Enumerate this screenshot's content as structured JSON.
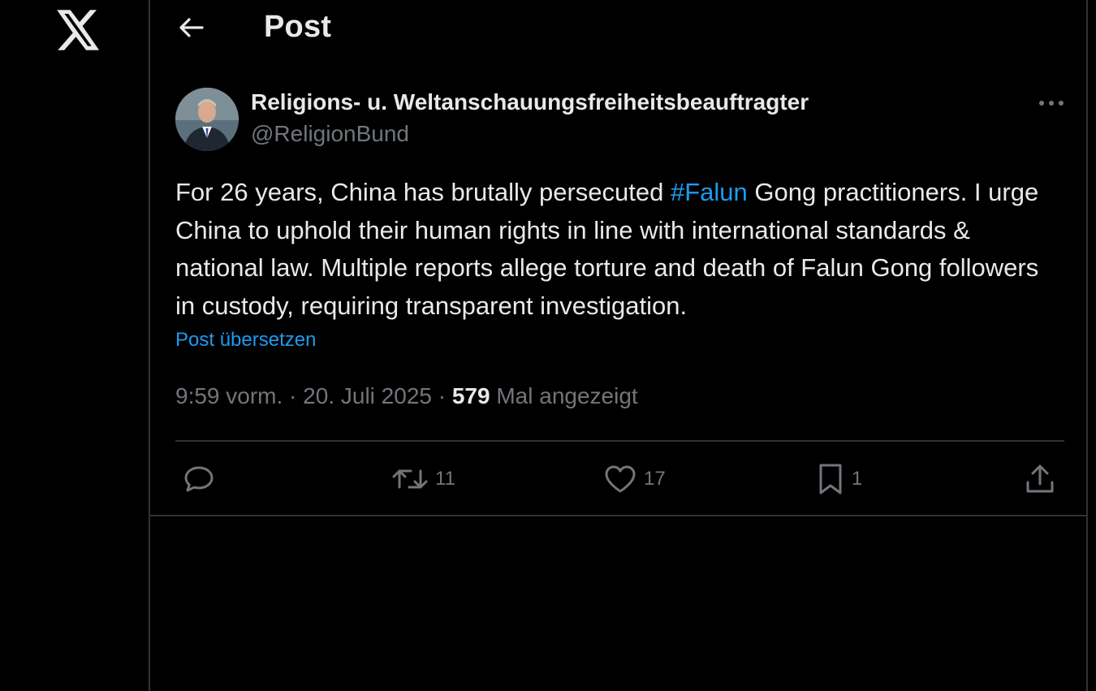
{
  "header": {
    "title": "Post"
  },
  "post": {
    "author": {
      "display_name": "Religions- u. Weltanschauungsfreiheitsbeauftragter",
      "handle": "@ReligionBund"
    },
    "text": {
      "before_hashtag": "For 26 years, China has brutally persecuted ",
      "hashtag": "#Falun",
      "after_hashtag": " Gong practitioners. I urge China to uphold their human rights in line with international standards & national law. Multiple reports allege torture and death of Falun Gong followers in custody, requiring transparent investigation."
    },
    "translate_label": "Post übersetzen",
    "meta": {
      "time": "9:59 vorm.",
      "separator": " · ",
      "date": "20. Juli 2025",
      "views_count": "579",
      "views_label": " Mal angezeigt"
    },
    "actions": {
      "reply_count": "",
      "repost_count": "11",
      "like_count": "17",
      "bookmark_count": "1"
    }
  },
  "colors": {
    "background": "#000000",
    "text_primary": "#e7e9ea",
    "text_secondary": "#71767b",
    "accent": "#1d9bf0",
    "border": "#2f3336"
  }
}
